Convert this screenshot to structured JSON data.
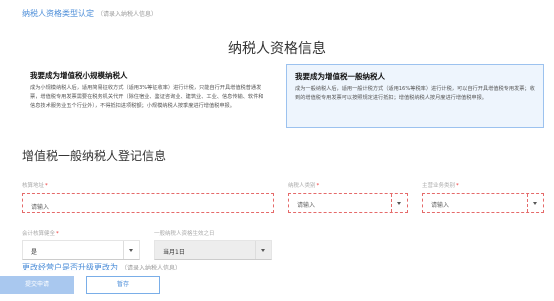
{
  "breadcrumb": {
    "title": "纳税人资格类型认定",
    "note": "（请录入纳税人信息）"
  },
  "page_title": "纳税人资格信息",
  "cards": {
    "small": {
      "heading": "我要成为增值税小规模纳税人",
      "body": "成为小规模纳税人后，适用简易征收方式（适用3%等征收率）进行计税，只能自行开具增值税普通发票，增值税专用发票需要在税务机关代开（除住宿业、鉴证咨询业、建筑业、工业、信息传输、软件和信息技术服务业五个行业外），不得抵扣进项税额；小规模纳税人按季度进行增值税申报。"
    },
    "general": {
      "heading": "我要成为增值税一般纳税人",
      "body": "成为一般纳税人后，适用一般计税方式（适用16%等税率）进行计税，可以自行开具增值税专用发票；收到的增值税专用发票可以按照规定进行抵扣；增值税纳税人按月度进行增值税申报。"
    }
  },
  "section_title": "增值税一般纳税人登记信息",
  "form": {
    "address": {
      "label": "核算地址",
      "placeholder": "请输入"
    },
    "taxpayer_category": {
      "label": "纳税人类别",
      "placeholder": "请输入"
    },
    "main_business_category": {
      "label": "主营业务类别",
      "placeholder": "请输入"
    },
    "accounting_sound": {
      "label": "会计核算健全",
      "value": "是"
    },
    "effective_date": {
      "label": "一般纳税人资格生效之日",
      "value": "当月1日"
    }
  },
  "next_section": {
    "title": "更改经营户是否升级更改为",
    "note": "（请录入纳税人信息）"
  },
  "buttons": {
    "submit": "提交申请",
    "save": "暂存"
  }
}
